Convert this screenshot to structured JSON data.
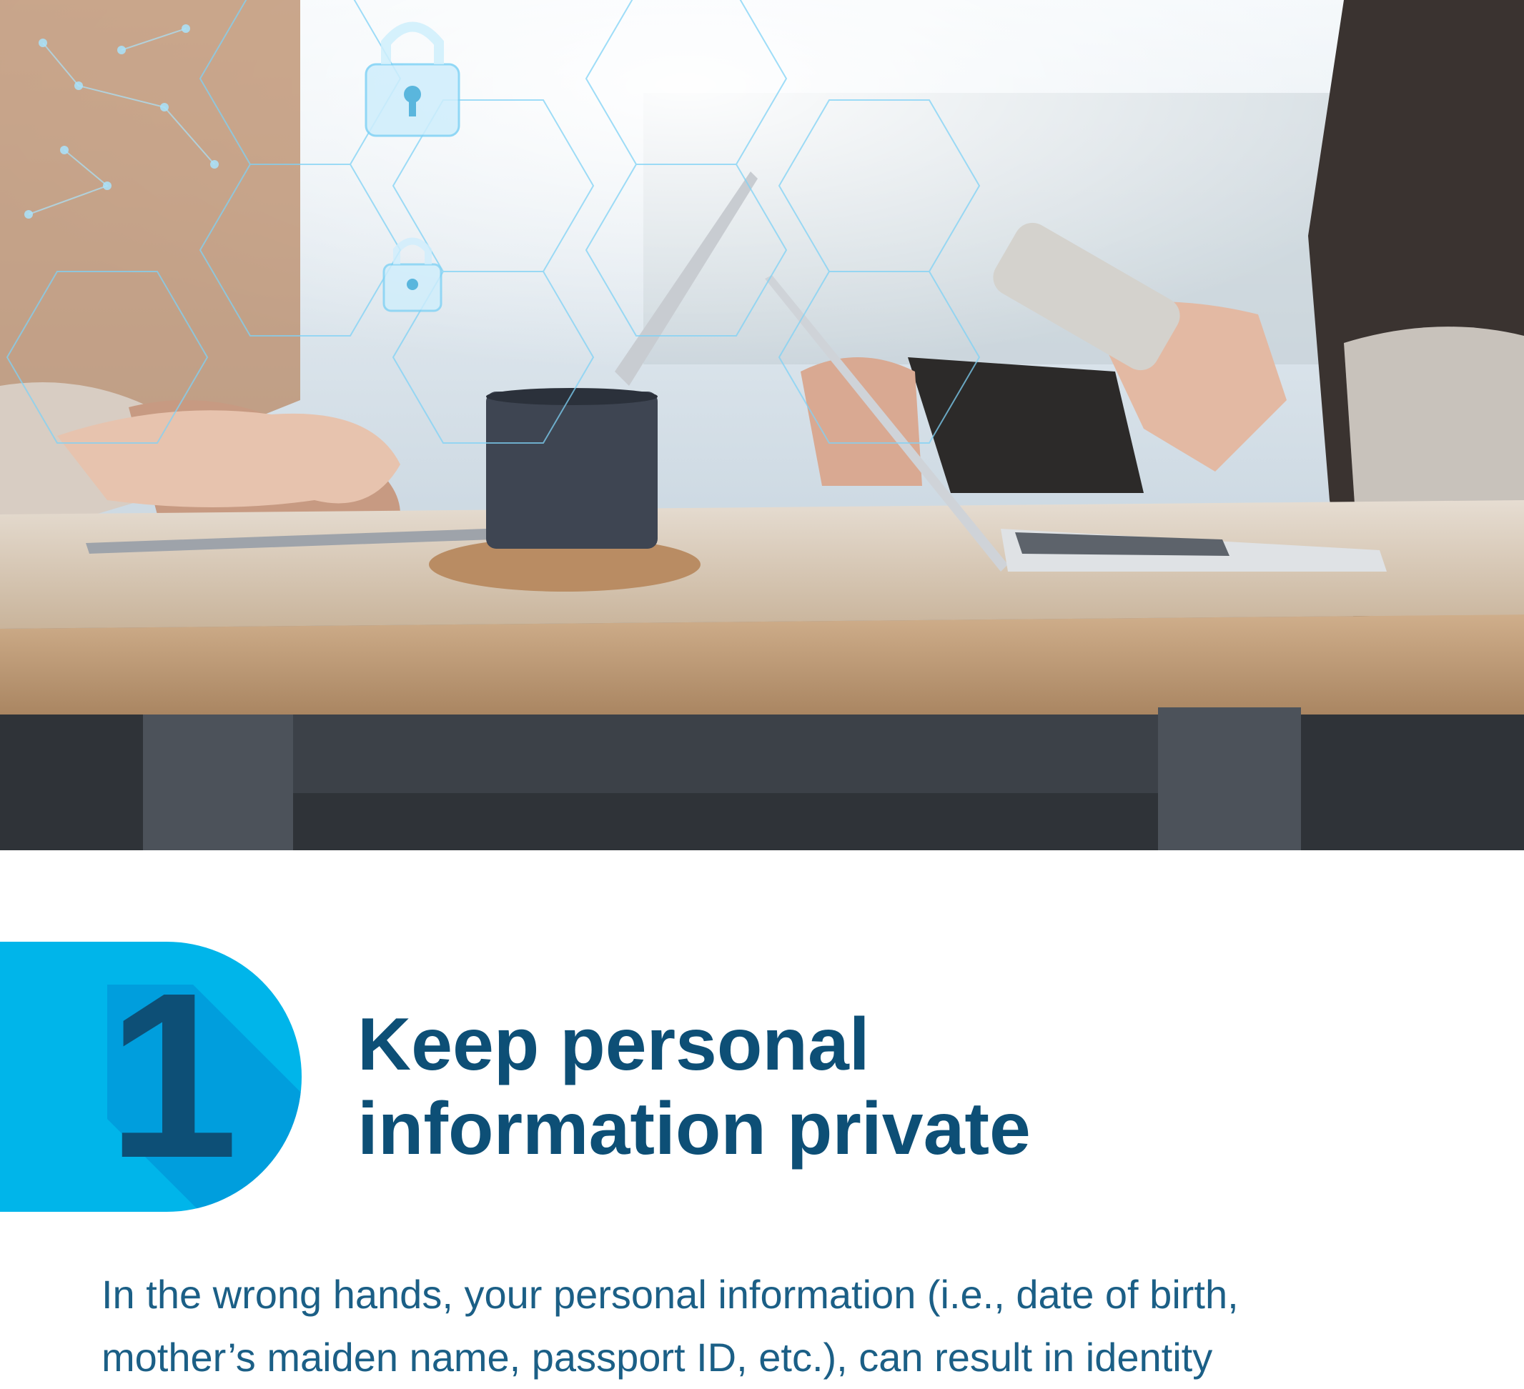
{
  "hero": {
    "image_alt": "People working at a table with laptops, a phone and a coffee cup, overlaid with digital security padlock graphics"
  },
  "section": {
    "number": "1",
    "title_lines": [
      "Keep personal",
      "information private"
    ],
    "body_lines": [
      "In the wrong hands, your personal information (i.e., date of birth,",
      "mother’s maiden name, passport ID, etc.), can result in identity"
    ]
  },
  "colors": {
    "badge": "#00b5ea",
    "badge_shadow": "#0098d9",
    "heading": "#0d4f76",
    "body": "#1b5f86"
  }
}
